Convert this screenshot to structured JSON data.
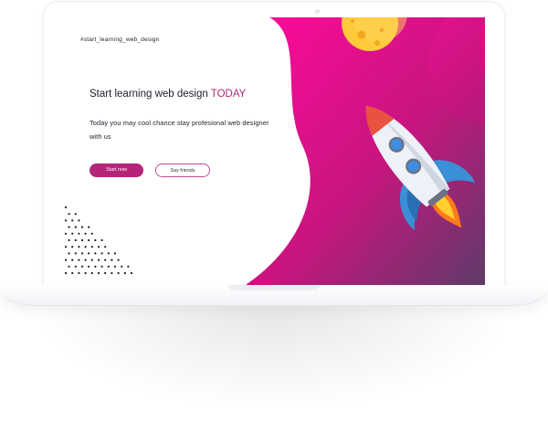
{
  "page": {
    "hashtag": "#start_learning_web_design",
    "headline_main": "Start learning web design ",
    "headline_accent": "TODAY",
    "subtext": "Today you may cool chance stay profesional web designer with  us",
    "buttons": {
      "start": "Start now",
      "friends": "Say friends"
    }
  },
  "colors": {
    "accent": "#b4257a",
    "background_magenta": "#ff0a9b",
    "background_purple": "#6c3d6e",
    "moon": "#ffc93c",
    "rocket_body": "#e9edf4",
    "rocket_nose": "#e8523f",
    "rocket_fins": "#3b8fd6",
    "rocket_window": "#3d8ee0",
    "flame": "#ffb400"
  },
  "icons": {
    "rocket": "rocket-illustration",
    "moon": "moon-illustration",
    "dots": "dot-pattern"
  }
}
